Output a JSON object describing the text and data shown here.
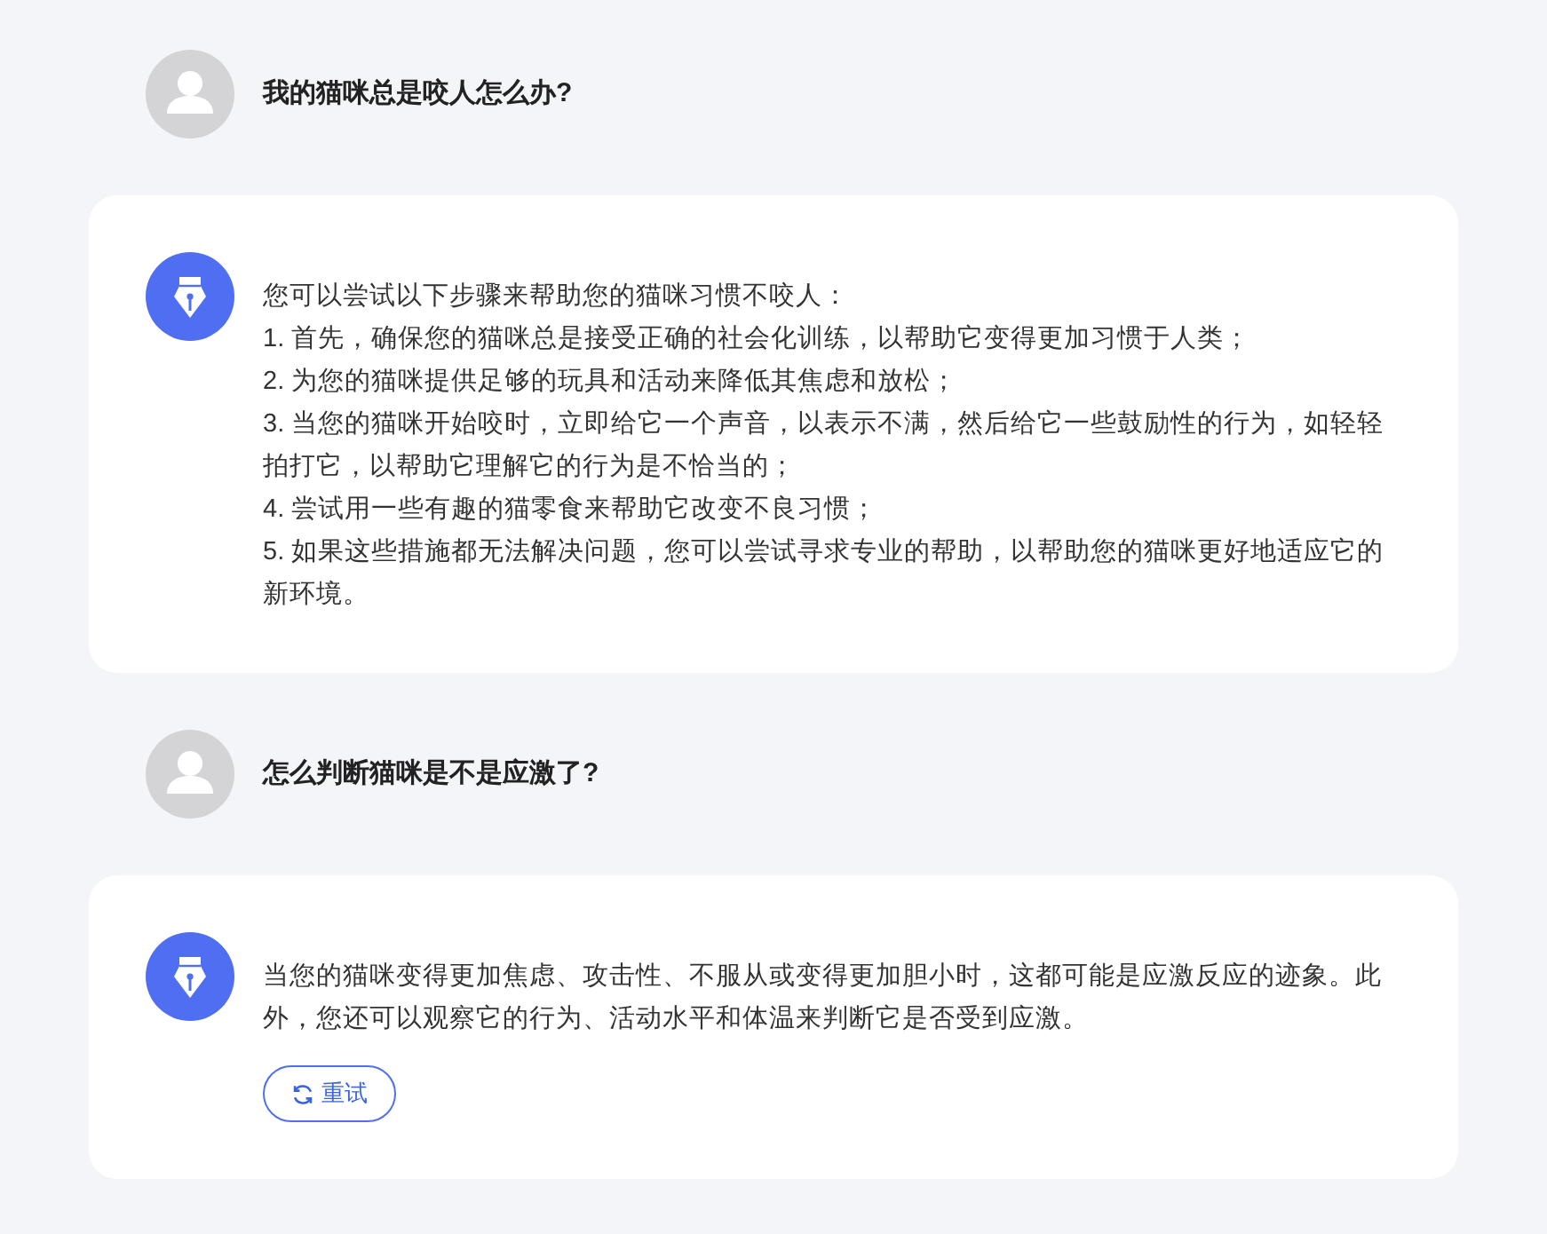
{
  "conversation": [
    {
      "kind": "question",
      "text": "我的猫咪总是咬人怎么办?"
    },
    {
      "kind": "answer",
      "paragraphs": [
        "您可以尝试以下步骤来帮助您的猫咪习惯不咬人：",
        "1. 首先，确保您的猫咪总是接受正确的社会化训练，以帮助它变得更加习惯于人类；",
        "2. 为您的猫咪提供足够的玩具和活动来降低其焦虑和放松；",
        "3. 当您的猫咪开始咬时，立即给它一个声音，以表示不满，然后给它一些鼓励性的行为，如轻轻拍打它，以帮助它理解它的行为是不恰当的；",
        "4. 尝试用一些有趣的猫零食来帮助它改变不良习惯；",
        "5. 如果这些措施都无法解决问题，您可以尝试寻求专业的帮助，以帮助您的猫咪更好地适应它的新环境。"
      ]
    },
    {
      "kind": "question",
      "text": "怎么判断猫咪是不是应激了?"
    },
    {
      "kind": "answer",
      "paragraphs": [
        "当您的猫咪变得更加焦虑、攻击性、不服从或变得更加胆小时，这都可能是应激反应的迹象。此外，您还可以观察它的行为、活动水平和体温来判断它是否受到应激。"
      ],
      "retry_button": "重试"
    }
  ]
}
